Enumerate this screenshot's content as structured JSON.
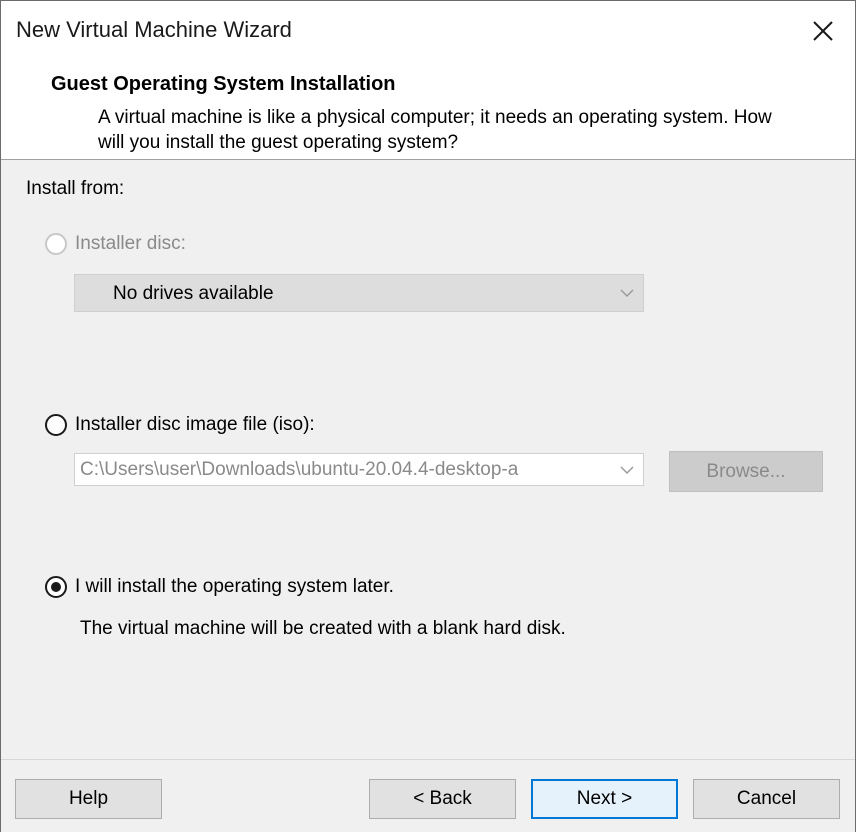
{
  "window": {
    "title": "New Virtual Machine Wizard"
  },
  "header": {
    "title": "Guest Operating System Installation",
    "description": "A virtual machine is like a physical computer; it needs an operating system. How will you install the guest operating system?"
  },
  "install_from_label": "Install from:",
  "options": {
    "installer_disc": {
      "label": "Installer disc:",
      "selected": false,
      "enabled": false,
      "dropdown_value": "No drives available"
    },
    "iso": {
      "label": "Installer disc image file (iso):",
      "selected": false,
      "enabled": true,
      "path_value": "C:\\Users\\user\\Downloads\\ubuntu-20.04.4-desktop-a",
      "browse_label": "Browse..."
    },
    "later": {
      "label": "I will install the operating system later.",
      "selected": true,
      "enabled": true,
      "note": "The virtual machine will be created with a blank hard disk."
    }
  },
  "buttons": {
    "help": "Help",
    "back": "< Back",
    "next": "Next >",
    "cancel": "Cancel"
  },
  "icons": {
    "close": "close-icon",
    "dropdown": "chevron-down-icon"
  }
}
